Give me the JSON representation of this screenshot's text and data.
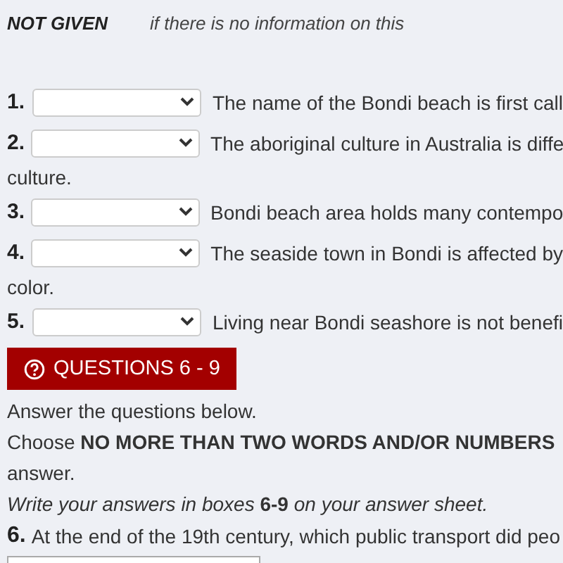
{
  "legend": {
    "term": "NOT GIVEN",
    "meaning": "if there is no information on this"
  },
  "tf_questions": [
    {
      "number": "1.",
      "lines": [
        "The name of the Bondi beach is first call"
      ]
    },
    {
      "number": "2.",
      "lines": [
        "The aboriginal culture in Australia is diffe",
        "culture."
      ]
    },
    {
      "number": "3.",
      "lines": [
        "Bondi beach area holds many contempo"
      ]
    },
    {
      "number": "4.",
      "lines": [
        "The seaside town in Bondi is affected by",
        "color."
      ]
    },
    {
      "number": "5.",
      "lines": [
        "Living near Bondi seashore is not benefi"
      ]
    }
  ],
  "section": {
    "title": "QUESTIONS 6 - 9"
  },
  "instructions": [
    {
      "kind": "plain",
      "text": "Answer the questions below."
    },
    {
      "kind": "plain",
      "text": "Choose **NO MORE THAN TWO WORDS AND/OR NUMBERS**"
    },
    {
      "kind": "plain",
      "text": "answer."
    },
    {
      "kind": "note",
      "text": "Write your answers in boxes **6-9** on your answer sheet."
    }
  ],
  "questions": [
    {
      "number": "6.",
      "text": "At the end of the 19th century, which public transport did peo"
    }
  ]
}
